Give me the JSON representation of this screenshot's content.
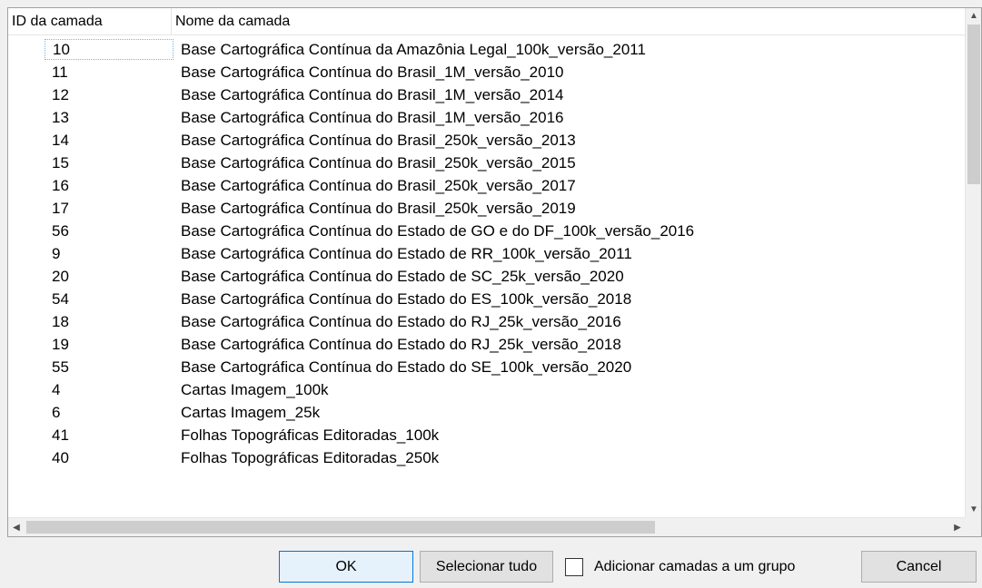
{
  "table": {
    "columns": [
      "ID da camada",
      "Nome da camada"
    ],
    "rows": [
      {
        "id": "10",
        "name": "Base Cartográfica Contínua da Amazônia Legal_100k_versão_2011"
      },
      {
        "id": "11",
        "name": "Base Cartográfica Contínua do Brasil_1M_versão_2010"
      },
      {
        "id": "12",
        "name": "Base Cartográfica Contínua do Brasil_1M_versão_2014"
      },
      {
        "id": "13",
        "name": "Base Cartográfica Contínua do Brasil_1M_versão_2016"
      },
      {
        "id": "14",
        "name": "Base Cartográfica Contínua do Brasil_250k_versão_2013"
      },
      {
        "id": "15",
        "name": "Base Cartográfica Contínua do Brasil_250k_versão_2015"
      },
      {
        "id": "16",
        "name": "Base Cartográfica Contínua do Brasil_250k_versão_2017"
      },
      {
        "id": "17",
        "name": "Base Cartográfica Contínua do Brasil_250k_versão_2019"
      },
      {
        "id": "56",
        "name": "Base Cartográfica Contínua do Estado de GO e do DF_100k_versão_2016"
      },
      {
        "id": "9",
        "name": "Base Cartográfica Contínua do Estado de RR_100k_versão_2011"
      },
      {
        "id": "20",
        "name": "Base Cartográfica Contínua do Estado de SC_25k_versão_2020"
      },
      {
        "id": "54",
        "name": "Base Cartográfica Contínua do Estado do ES_100k_versão_2018"
      },
      {
        "id": "18",
        "name": "Base Cartográfica Contínua do Estado do RJ_25k_versão_2016"
      },
      {
        "id": "19",
        "name": "Base Cartográfica Contínua do Estado do RJ_25k_versão_2018"
      },
      {
        "id": "55",
        "name": "Base Cartográfica Contínua do Estado do SE_100k_versão_2020"
      },
      {
        "id": "4",
        "name": "Cartas Imagem_100k"
      },
      {
        "id": "6",
        "name": "Cartas Imagem_25k"
      },
      {
        "id": "41",
        "name": "Folhas Topográficas Editoradas_100k"
      },
      {
        "id": "40",
        "name": "Folhas Topográficas Editoradas_250k"
      }
    ]
  },
  "buttons": {
    "ok": "OK",
    "select_all": "Selecionar tudo",
    "cancel": "Cancel"
  },
  "checkbox": {
    "label": "Adicionar camadas a um grupo",
    "checked": false
  },
  "icons": {
    "scroll_up": "triangle-up-icon",
    "scroll_down": "triangle-down-icon",
    "scroll_left": "triangle-left-icon",
    "scroll_right": "triangle-right-icon"
  },
  "colors": {
    "focus_border": "#7ab3e6",
    "default_button_border": "#0078d7"
  }
}
